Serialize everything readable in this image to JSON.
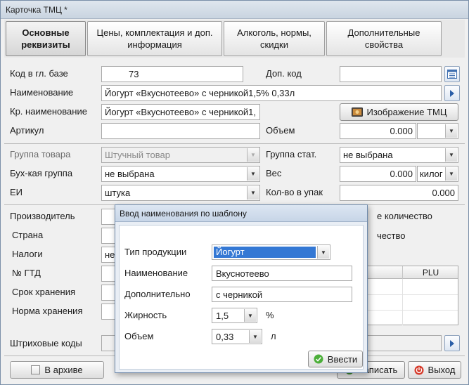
{
  "window": {
    "title": "Карточка ТМЦ *"
  },
  "tabs": [
    {
      "label": "Основные реквизиты"
    },
    {
      "label": "Цены, комплектация и доп.  информация"
    },
    {
      "label": "Алкоголь, нормы, скидки"
    },
    {
      "label": "Дополнительные свойства"
    }
  ],
  "form": {
    "code_label": "Код в гл. базе",
    "code_value": "73",
    "extra_code_label": "Доп. код",
    "extra_code_value": "",
    "name_label": "Наименование",
    "name_value": "Йогурт «Вкуснотеево» с черникой1,5% 0,33л",
    "short_name_label": "Кр. наименование",
    "short_name_value": "Йогурт «Вкуснотеево» с черникой1,",
    "image_button": "Изображение ТМЦ",
    "article_label": "Артикул",
    "article_value": "",
    "volume_label": "Объем",
    "volume_value": "0.000",
    "volume_unit": "",
    "group_label": "Группа товара",
    "group_value": "Штучный товар",
    "stat_group_label": "Группа стат.",
    "stat_group_value": "не выбрана",
    "acc_group_label": "Бух-кая группа",
    "acc_group_value": "не выбрана",
    "weight_label": "Вес",
    "weight_value": "0.000",
    "weight_unit": "килог",
    "unit_label": "ЕИ",
    "unit_value": "штука",
    "pack_qty_label": "Кол-во в упак",
    "pack_qty_value": "0.000",
    "manufacturer_label": "Производитель",
    "country_label": "Страна",
    "taxes_label": "Налоги",
    "taxes_value_partial": "не",
    "gtd_label": "№ ГТД",
    "shelf_life_label": "Срок хранения",
    "storage_norm_label": "Норма хранения",
    "right_text_1": "е количество",
    "right_text_2": "чество",
    "plu_header": "PLU",
    "barcodes_label": "Штриховые коды",
    "archive_label": "В архиве",
    "save_button": "Записать",
    "exit_button": "Выход"
  },
  "dialog": {
    "title": "Ввод наименования по шаблону",
    "product_type_label": "Тип продукции",
    "product_type_value": "Йогурт",
    "name_label": "Наименование",
    "name_value": "Вкуснотеево",
    "additional_label": "Дополнительно",
    "additional_value": "с черникой",
    "fat_label": "Жирность",
    "fat_value": "1,5",
    "fat_unit": "%",
    "volume_label": "Объем",
    "volume_value": "0,33",
    "volume_unit": "л",
    "submit_button": "Ввести"
  }
}
